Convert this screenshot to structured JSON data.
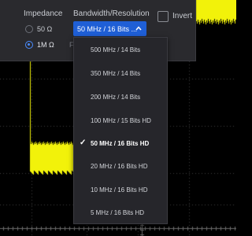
{
  "panel": {
    "impedance_label": "Impedance",
    "impedance_options": [
      {
        "label": "50 Ω",
        "selected": false
      },
      {
        "label": "1M Ω",
        "selected": true
      }
    ],
    "bandwidth_label": "Bandwidth/Resolution",
    "bandwidth_value": "50 MHz / 16 Bits ...",
    "invert_label": "Invert",
    "invert_checked": false,
    "partial_label": "F"
  },
  "dropdown": {
    "options": [
      {
        "label": "500 MHz / 14 Bits",
        "selected": false
      },
      {
        "label": "350 MHz / 14 Bits",
        "selected": false
      },
      {
        "label": "200 MHz / 14 Bits",
        "selected": false
      },
      {
        "label": "100 MHz / 15 Bits HD",
        "selected": false
      },
      {
        "label": "50 MHz / 16 Bits HD",
        "selected": true
      },
      {
        "label": "20 MHz / 16 Bits HD",
        "selected": false
      },
      {
        "label": "10 MHz / 16 Bits HD",
        "selected": false
      },
      {
        "label": "5 MHz / 16 Bits HD",
        "selected": false
      }
    ]
  },
  "colors": {
    "trace": "#f2f20a",
    "accent": "#1f5fd6",
    "grid": "#3c3c3c"
  },
  "icons": {
    "selected_check": "✓",
    "dropdown_chevron": "chevron-up-icon"
  }
}
